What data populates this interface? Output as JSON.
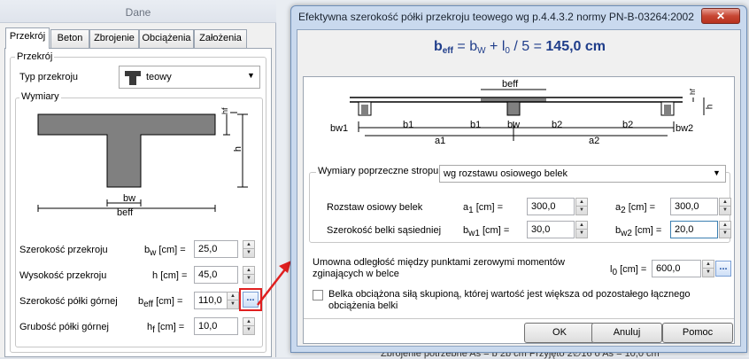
{
  "left_panel": {
    "title": "Dane",
    "tabs": [
      "Przekrój",
      "Beton",
      "Zbrojenie",
      "Obciążenia",
      "Założenia"
    ],
    "group_title": "Przekrój",
    "section_type_label": "Typ przekroju",
    "section_type_value": "teowy",
    "dims_title": "Wymiary",
    "diagram": {
      "hf": "hf",
      "h": "h",
      "bw": "bw",
      "beff": "beff"
    },
    "fields": [
      {
        "label": "Szerokość przekroju",
        "sym": "b",
        "sub": "w",
        "unit": "[cm] =",
        "value": "25,0"
      },
      {
        "label": "Wysokość przekroju",
        "sym": "h",
        "sub": "",
        "unit": "[cm] =",
        "value": "45,0"
      },
      {
        "label": "Szerokość półki górnej",
        "sym": "b",
        "sub": "eff",
        "unit": "[cm] =",
        "value": "110,0"
      },
      {
        "label": "Grubość półki górnej",
        "sym": "h",
        "sub": "f",
        "unit": "[cm] =",
        "value": "10,0"
      }
    ],
    "dots_label": "..."
  },
  "dialog": {
    "title": "Efektywna szerokość półki przekroju teowego wg p.4.4.3.2 normy PN-B-03264:2002",
    "close_label": "✕",
    "formula": {
      "lhs": "b",
      "lhs_sub": "eff",
      "eq": " = b",
      "bw_sub": "W",
      "plus": " + l",
      "l0_sub": "0",
      "rest": " / 5 = ",
      "result": "145,0 cm"
    },
    "diagram": {
      "beff": "beff",
      "hf": "hf",
      "h": "h",
      "bw1": "bw1",
      "b1": "b1",
      "bw": "bw",
      "b2": "b2",
      "bw2": "bw2",
      "a1": "a1",
      "a2": "a2"
    },
    "group_label": "Wymiary poprzeczne stropu",
    "group_select": "wg rozstawu osiowego belek",
    "rows": [
      {
        "label": "Rozstaw osiowy belek",
        "s1": "a",
        "s1_sub": "1",
        "u1": "[cm] =",
        "v1": "300,0",
        "s2": "a",
        "s2_sub": "2",
        "u2": "[cm] =",
        "v2": "300,0"
      },
      {
        "label": "Szerokość belki sąsiedniej",
        "s1": "b",
        "s1_sub": "w1",
        "u1": "[cm] =",
        "v1": "30,0",
        "s2": "b",
        "s2_sub": "w2",
        "u2": "[cm] =",
        "v2": "20,0"
      }
    ],
    "l0_label_1": "Umowna odległość między punktami zerowymi momentów",
    "l0_label_2": "zginających w belce",
    "l0_sym": "l",
    "l0_sub": "0",
    "l0_unit": "[cm] =",
    "l0_value": "600,0",
    "checkbox_label_1": "Belka obciążona siłą skupioną, której wartość jest większa od pozostałego łącznego",
    "checkbox_label_2": "obciążenia belki",
    "buttons": [
      "OK",
      "Anuluj",
      "Pomoc"
    ]
  },
  "background_text": "Zbrojenie potrzebne As = b 2b cm   Przyjęto 2∅16 o As = 10,0 cm",
  "colors": {
    "accent": "#1f3d8a",
    "highlight": "#e02020",
    "section_fill": "#808080"
  }
}
